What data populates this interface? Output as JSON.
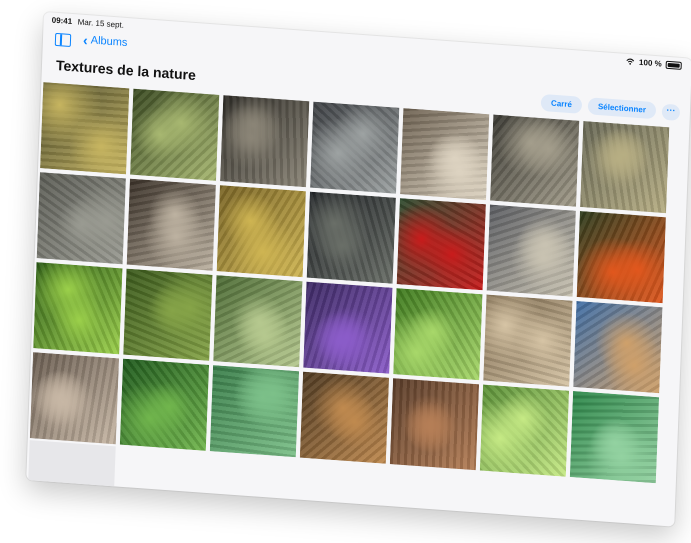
{
  "status": {
    "time": "09:41",
    "date": "Mar. 15 sept.",
    "battery": "100 %"
  },
  "nav": {
    "back_label": "Albums"
  },
  "album": {
    "title": "Textures de la nature"
  },
  "toolbar": {
    "square_label": "Carré",
    "select_label": "Sélectionner",
    "more_label": "···"
  },
  "add": {
    "label": "+"
  },
  "icons": [
    "sidebar-toggle-icon",
    "chevron-left-icon",
    "wifi-icon",
    "battery-icon",
    "more-icon",
    "plus-icon"
  ],
  "colors": {
    "accent": "#0a84ff",
    "pill_bg": "#dfe9f7"
  },
  "photos": [
    {
      "name": "pine-cone-scales",
      "c1": "#4a4a2c",
      "c2": "#c7b560"
    },
    {
      "name": "succulent-leaves",
      "c1": "#3b4b22",
      "c2": "#a8b871"
    },
    {
      "name": "tree-bark",
      "c1": "#2f2d28",
      "c2": "#8b8577"
    },
    {
      "name": "gravel-pebbles",
      "c1": "#3e4145",
      "c2": "#9ea3a3"
    },
    {
      "name": "cut-log",
      "c1": "#6d6151",
      "c2": "#ddd3c1"
    },
    {
      "name": "porous-stone",
      "c1": "#3b3a34",
      "c2": "#a49e8c"
    },
    {
      "name": "lichen-rock",
      "c1": "#6a6a58",
      "c2": "#b7ae83"
    },
    {
      "name": "boulder",
      "c1": "#5c5d56",
      "c2": "#9a9b92"
    },
    {
      "name": "palm-trunk",
      "c1": "#3a3128",
      "c2": "#bdb2a1"
    },
    {
      "name": "cactus-spines",
      "c1": "#7a6526",
      "c2": "#cfb552"
    },
    {
      "name": "dark-branches",
      "c1": "#1f2226",
      "c2": "#6a6f68"
    },
    {
      "name": "red-flower",
      "c1": "#2d4b2f",
      "c2": "#c91b1b"
    },
    {
      "name": "pebble-mosaic",
      "c1": "#5c5e63",
      "c2": "#c9c3b2"
    },
    {
      "name": "orange-flower",
      "c1": "#2d3d1e",
      "c2": "#e2571d"
    },
    {
      "name": "ferns",
      "c1": "#2b5b16",
      "c2": "#9bd04a"
    },
    {
      "name": "shrub",
      "c1": "#3b5a1c",
      "c2": "#86a448"
    },
    {
      "name": "agave",
      "c1": "#4c6b34",
      "c2": "#b6c98f"
    },
    {
      "name": "purple-flower",
      "c1": "#3d2a64",
      "c2": "#8b5cc9"
    },
    {
      "name": "green-foliage",
      "c1": "#3e7a1e",
      "c2": "#a8d86a"
    },
    {
      "name": "seed-heads",
      "c1": "#7d6a4e",
      "c2": "#d6c4a5"
    },
    {
      "name": "blue-sky-plant",
      "c1": "#3f6ea6",
      "c2": "#cfa06a"
    },
    {
      "name": "bark-chips",
      "c1": "#6b5e52",
      "c2": "#c7b7a5"
    },
    {
      "name": "ivy",
      "c1": "#1f5a1d",
      "c2": "#71b64d"
    },
    {
      "name": "green-leaf",
      "c1": "#3a7e4a",
      "c2": "#7cc089"
    },
    {
      "name": "dried-flower",
      "c1": "#4f3a22",
      "c2": "#c08a4f"
    },
    {
      "name": "wood-grain",
      "c1": "#5a3d2a",
      "c2": "#b57e56"
    },
    {
      "name": "succulent-rosette",
      "c1": "#5b9138",
      "c2": "#c6ea85"
    },
    {
      "name": "leaf-veins",
      "c1": "#2b8648",
      "c2": "#93d2a1"
    }
  ]
}
